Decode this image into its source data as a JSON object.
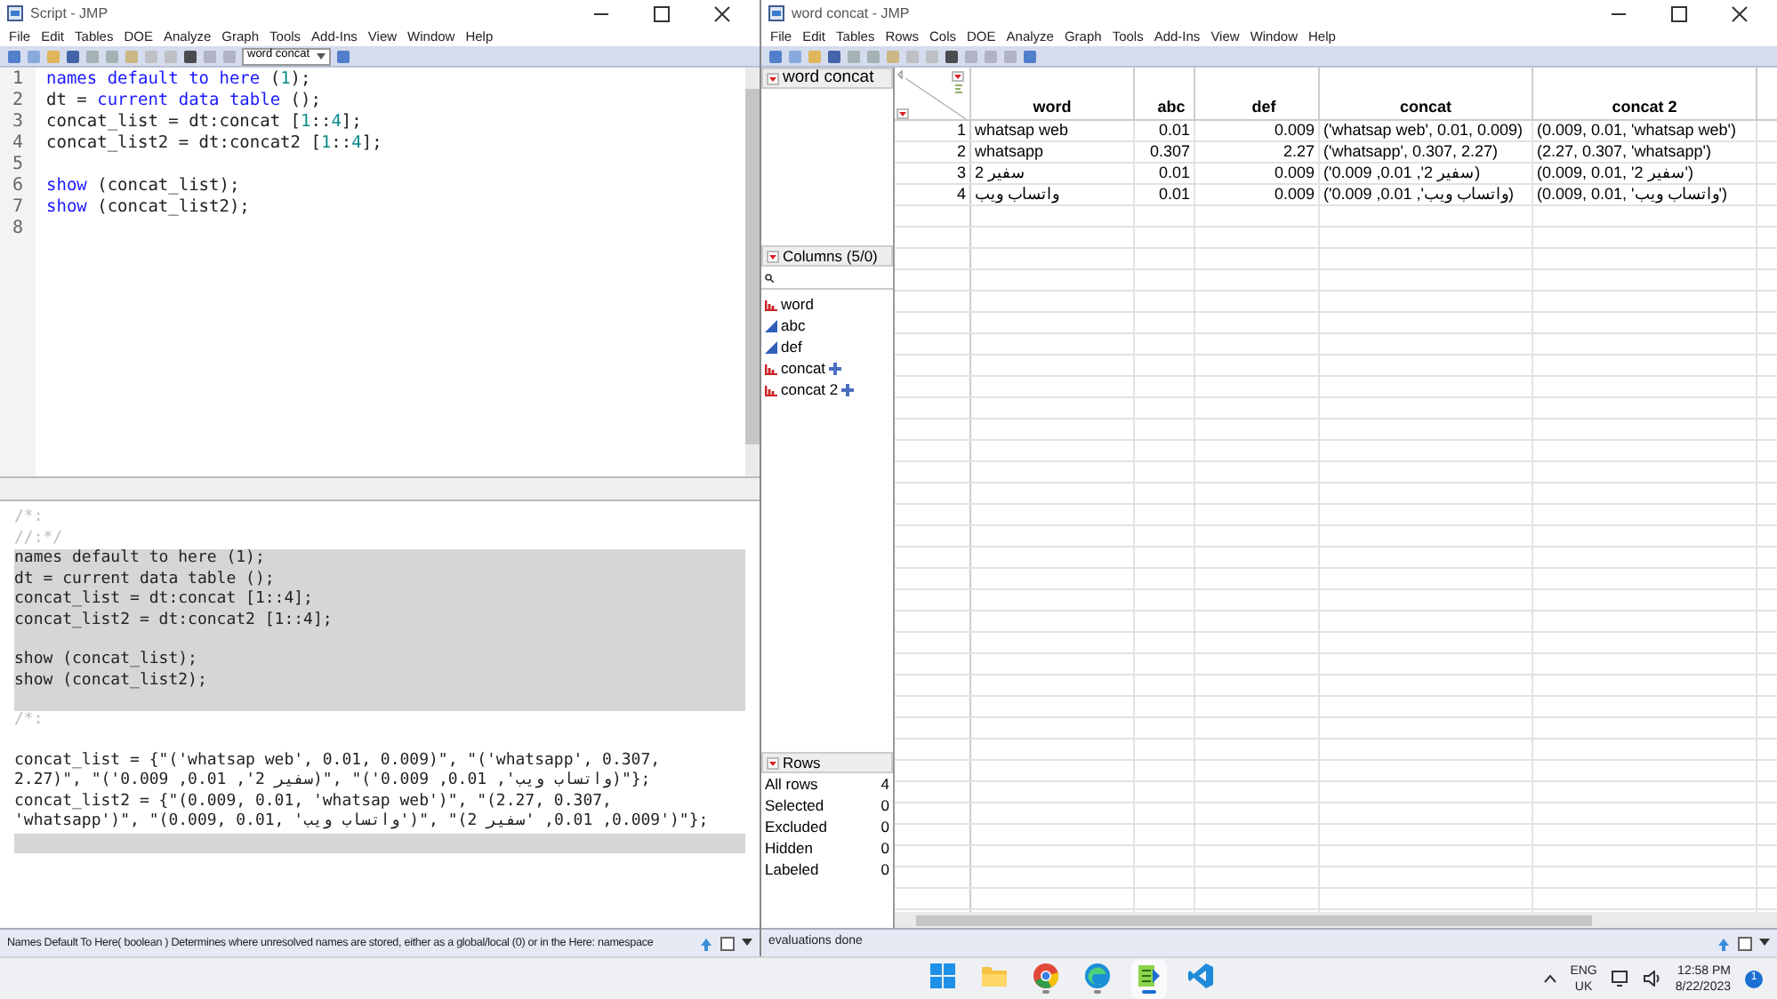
{
  "script_window": {
    "title": "Script - JMP",
    "menu": [
      "File",
      "Edit",
      "Tables",
      "DOE",
      "Analyze",
      "Graph",
      "Tools",
      "Add-Ins",
      "View",
      "Window",
      "Help"
    ],
    "table_selector": "word concat",
    "code_lines": [
      {
        "number": "1",
        "tokens": [
          {
            "text": "names default to here",
            "kind": "keyword"
          },
          {
            "text": " (",
            "kind": "plain"
          },
          {
            "text": "1",
            "kind": "number"
          },
          {
            "text": ");",
            "kind": "plain"
          }
        ]
      },
      {
        "number": "2",
        "tokens": [
          {
            "text": "dt = ",
            "kind": "plain"
          },
          {
            "text": "current data table",
            "kind": "keyword"
          },
          {
            "text": " ();",
            "kind": "plain"
          }
        ]
      },
      {
        "number": "3",
        "tokens": [
          {
            "text": "concat_list = dt:concat [",
            "kind": "plain"
          },
          {
            "text": "1",
            "kind": "number"
          },
          {
            "text": "::",
            "kind": "plain"
          },
          {
            "text": "4",
            "kind": "number"
          },
          {
            "text": "];",
            "kind": "plain"
          }
        ]
      },
      {
        "number": "4",
        "tokens": [
          {
            "text": "concat_list2 = dt:concat2 [",
            "kind": "plain"
          },
          {
            "text": "1",
            "kind": "number"
          },
          {
            "text": "::",
            "kind": "plain"
          },
          {
            "text": "4",
            "kind": "number"
          },
          {
            "text": "];",
            "kind": "plain"
          }
        ]
      },
      {
        "number": "5"
      },
      {
        "number": "6",
        "tokens": [
          {
            "text": "show",
            "kind": "keyword"
          },
          {
            "text": " (concat_list);",
            "kind": "plain"
          }
        ]
      },
      {
        "number": "7",
        "tokens": [
          {
            "text": "show",
            "kind": "keyword"
          },
          {
            "text": " (concat_list2);",
            "kind": "plain"
          }
        ]
      },
      {
        "number": "8"
      }
    ],
    "log_comments": [
      "/*:",
      "//:*/"
    ],
    "log_echo_blocks": [
      [
        "names default to here (1);",
        "dt = current data table ();",
        "concat_list = dt:concat [1::4];",
        "concat_list2 = dt:concat2 [1::4];"
      ],
      [
        "show (concat_list);",
        "show (concat_list2);"
      ]
    ],
    "log_separator": "/*:",
    "log_output": [
      "concat_list = {\"('whatsap web', 0.01, 0.009)\", \"('whatsapp', 0.307,",
      "2.27)\", \"('سفير 2', 0.01, 0.009)\", \"('واتساب ويب', 0.01, 0.009)\"};",
      "concat_list2 = {\"(0.009, 0.01, 'whatsap web')\", \"(2.27, 0.307,",
      "'whatsapp')\", \"(0.009, 0.01, 'واتساب ويب')\", \"(0.009, 0.01, 'سفير 2')\"};"
    ],
    "status_bar": "Names Default To Here( boolean ) Determines where unresolved names are stored, either as a global/local (0) or in the Here: namespace"
  },
  "data_window": {
    "title": "word concat - JMP",
    "menu": [
      "File",
      "Edit",
      "Tables",
      "Rows",
      "Cols",
      "DOE",
      "Analyze",
      "Graph",
      "Tools",
      "Add-Ins",
      "View",
      "Window",
      "Help"
    ],
    "table_panel_title": "word concat",
    "columns_panel_title": "Columns (5/0)",
    "column_list": [
      {
        "name": "word",
        "kind": "nominal",
        "formula": false
      },
      {
        "name": "abc",
        "kind": "continuous",
        "formula": false
      },
      {
        "name": "def",
        "kind": "continuous",
        "formula": false
      },
      {
        "name": "concat",
        "kind": "nominal",
        "formula": true
      },
      {
        "name": "concat 2",
        "kind": "nominal",
        "formula": true
      }
    ],
    "rows_panel_title": "Rows",
    "rows_stats": [
      {
        "label": "All rows",
        "value": "4"
      },
      {
        "label": "Selected",
        "value": "0"
      },
      {
        "label": "Excluded",
        "value": "0"
      },
      {
        "label": "Hidden",
        "value": "0"
      },
      {
        "label": "Labeled",
        "value": "0"
      }
    ],
    "table": {
      "columns": [
        {
          "label": "word",
          "kind": "character"
        },
        {
          "label": "abc",
          "kind": "numeric"
        },
        {
          "label": "def",
          "kind": "numeric"
        },
        {
          "label": "concat",
          "kind": "character"
        },
        {
          "label": "concat 2",
          "kind": "character"
        }
      ],
      "rows": [
        {
          "number": "1",
          "cells": [
            "whatsap web",
            "0.01",
            "0.009",
            "('whatsap web', 0.01, 0.009)",
            "(0.009, 0.01, 'whatsap web')"
          ]
        },
        {
          "number": "2",
          "cells": [
            "whatsapp",
            "0.307",
            "2.27",
            "('whatsapp', 0.307, 2.27)",
            "(2.27, 0.307, 'whatsapp')"
          ]
        },
        {
          "number": "3",
          "cells": [
            "سفير 2",
            "0.01",
            "0.009",
            "('سفير 2', 0.01, 0.009)",
            "(0.009, 0.01, 'سفير 2')"
          ]
        },
        {
          "number": "4",
          "cells": [
            "واتساب ويب",
            "0.01",
            "0.009",
            "('واتساب ويب', 0.01, 0.009)",
            "(0.009, 0.01, 'واتساب ويب')"
          ]
        }
      ]
    },
    "status_bar": "evaluations done"
  },
  "taskbar": {
    "apps": [
      {
        "kind": "start",
        "running": false,
        "selected": false
      },
      {
        "kind": "folder",
        "running": false,
        "selected": false
      },
      {
        "kind": "chrome",
        "running": true,
        "selected": false
      },
      {
        "kind": "edge",
        "running": true,
        "selected": false
      },
      {
        "kind": "jmp",
        "running": true,
        "selected": true
      },
      {
        "kind": "vscode",
        "running": false,
        "selected": false
      }
    ],
    "language": "ENG",
    "region": "UK",
    "time": "12:58 PM",
    "date": "8/22/2023",
    "notifications": "1"
  }
}
